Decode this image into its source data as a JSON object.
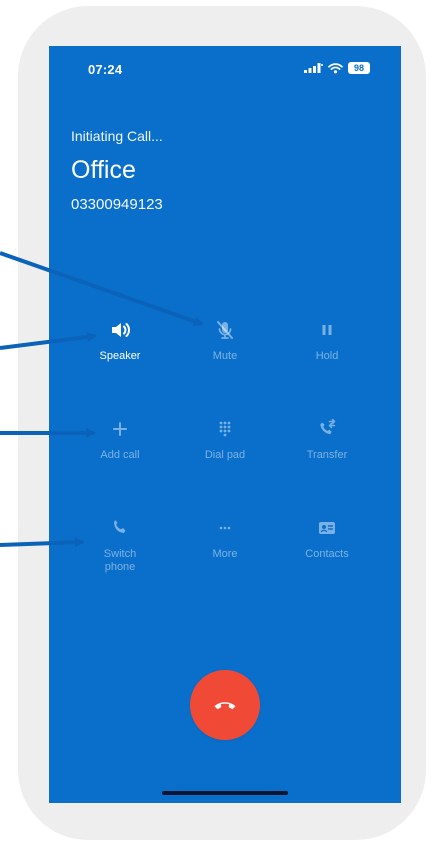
{
  "status_bar": {
    "time": "07:24",
    "battery": "98",
    "icons": [
      "moon-icon",
      "cellular-signal-icon",
      "wifi-icon",
      "battery-icon"
    ]
  },
  "call": {
    "status": "Initiating Call...",
    "name": "Office",
    "number": "03300949123"
  },
  "controls": [
    {
      "label": "Speaker",
      "icon": "speaker-icon",
      "active": true
    },
    {
      "label": "Mute",
      "icon": "mic-off-icon",
      "active": false
    },
    {
      "label": "Hold",
      "icon": "pause-icon",
      "active": false
    },
    {
      "label": "Add call",
      "icon": "plus-icon",
      "active": false
    },
    {
      "label": "Dial pad",
      "icon": "dialpad-icon",
      "active": false
    },
    {
      "label": "Transfer",
      "icon": "transfer-call-icon",
      "active": false
    },
    {
      "label": "Switch\nphone",
      "icon": "phone-icon",
      "active": false
    },
    {
      "label": "More",
      "icon": "more-icon",
      "active": false
    },
    {
      "label": "Contacts",
      "icon": "contact-card-icon",
      "active": false
    }
  ],
  "end_call": {
    "icon": "end-call-icon"
  },
  "colors": {
    "screen_background": "#0a6fcb",
    "end_call": "#f04a36",
    "annotation_arrow": "#0a63b8"
  }
}
